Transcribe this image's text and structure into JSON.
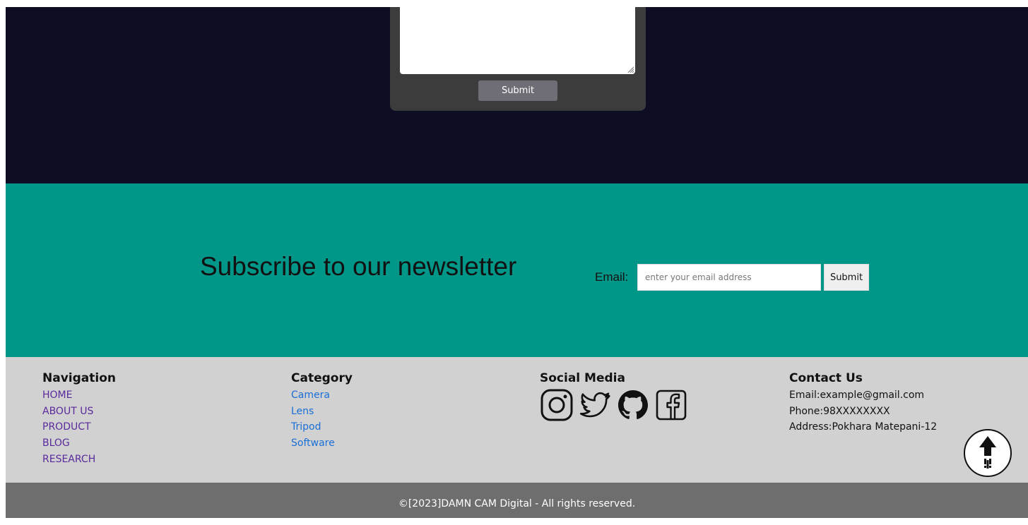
{
  "contact_form": {
    "message_value": "",
    "submit_label": "Submit"
  },
  "newsletter": {
    "title": "Subscribe to our newsletter",
    "email_label": "Email:",
    "email_placeholder": "enter your email address",
    "submit_label": "Submit"
  },
  "footer": {
    "navigation": {
      "heading": "Navigation",
      "items": [
        "HOME",
        "ABOUT US",
        "PRODUCT",
        "BLOG",
        "RESEARCH"
      ]
    },
    "category": {
      "heading": "Category",
      "items": [
        "Camera",
        "Lens",
        "Tripod",
        "Software"
      ]
    },
    "social": {
      "heading": "Social Media",
      "icons": [
        "instagram-icon",
        "twitter-icon",
        "github-icon",
        "facebook-icon"
      ]
    },
    "contact": {
      "heading": "Contact Us",
      "email": "Email:example@gmail.com",
      "phone": "Phone:98XXXXXXXX",
      "address": "Address:Pokhara Matepani-12"
    }
  },
  "scroll_top": {
    "icon": "arrow-up-icon"
  },
  "copyright": "©[2023]DAMN CAM Digital - All rights reserved.",
  "colors": {
    "dark_section": "#0d0e23",
    "form_card": "#3c3c3c",
    "newsletter_bg": "#009688",
    "footer_bg": "#d1d1d1",
    "copyright_bg": "#6e6e6e"
  }
}
